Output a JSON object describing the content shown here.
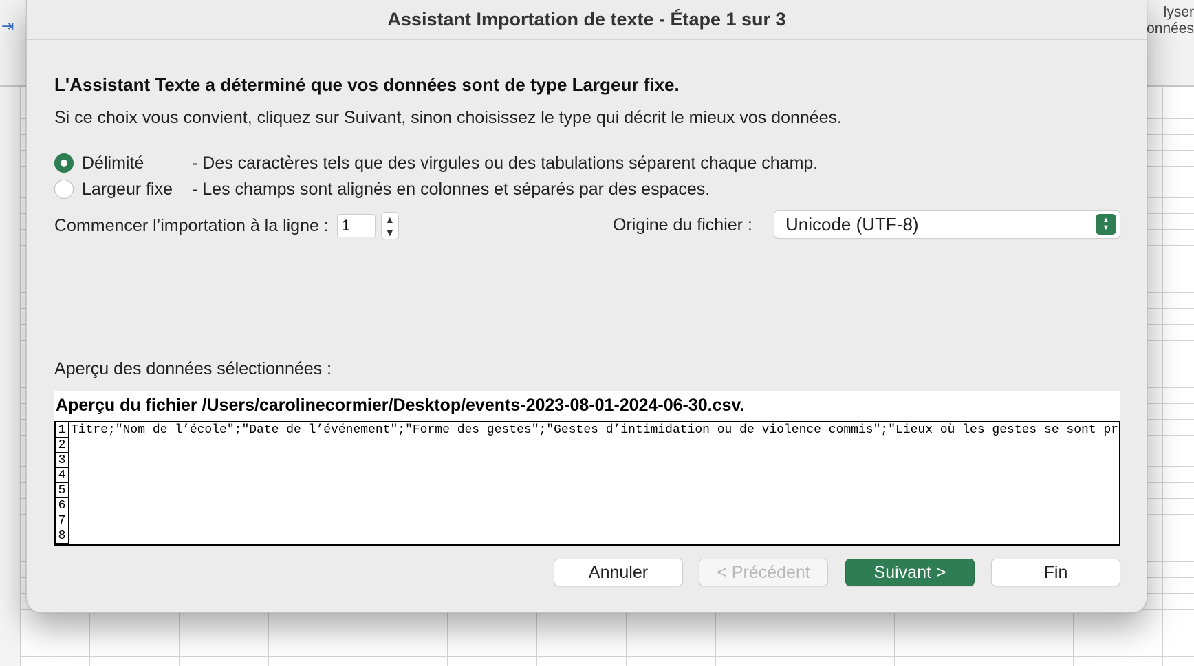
{
  "background": {
    "right_text_lines": [
      "lyser",
      "onnées"
    ]
  },
  "dialog": {
    "title": "Assistant Importation de texte - Étape 1 sur 3",
    "heading": "L'Assistant Texte a déterminé que vos données sont de type Largeur fixe.",
    "subtext": "Si ce choix vous convient, cliquez sur Suivant, sinon choisissez le type qui décrit le mieux vos données.",
    "radios": [
      {
        "label": "Délimité",
        "description": "- Des caractères tels que des virgules ou des tabulations séparent chaque champ.",
        "selected": true
      },
      {
        "label": "Largeur fixe",
        "description": "- Les champs sont alignés en colonnes et séparés par des espaces.",
        "selected": false
      }
    ],
    "start_row_label": "Commencer l’importation à la ligne :",
    "start_row_value": "1",
    "origin_label": "Origine du fichier :",
    "origin_value": "Unicode (UTF-8)",
    "preview_label": "Aperçu des données sélectionnées :",
    "preview_title": "Aperçu du fichier /Users/carolinecormier/Desktop/events-2023-08-01-2024-06-30.csv.",
    "preview_rows": [
      "1",
      "2",
      "3",
      "4",
      "5",
      "6",
      "7",
      "8"
    ],
    "preview_line_1": "Titre;\"Nom de l’école\";\"Date de l’événement\";\"Forme des gestes\";\"Gestes d’intimidation ou de violence commis\";\"Lieux où les gestes se sont produits\";\"Int",
    "buttons": {
      "cancel": "Annuler",
      "previous": "< Précédent",
      "next": "Suivant >",
      "finish": "Fin"
    }
  },
  "colors": {
    "accent": "#2f7d53",
    "dialog_bg": "#ececec"
  },
  "icons": {
    "stepper_up": "▲",
    "stepper_down": "▼",
    "select_up": "▲",
    "select_down": "▼",
    "ribbon_indent": "⇥"
  }
}
